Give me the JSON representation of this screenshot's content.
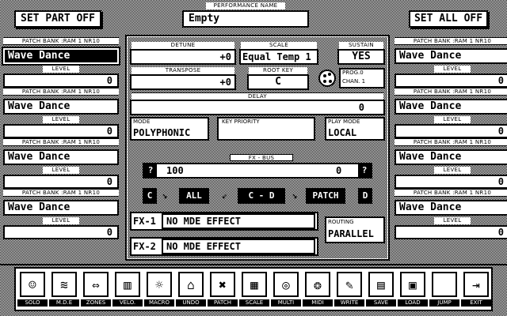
{
  "header": {
    "set_part_off": "SET PART OFF",
    "performance_name_label": "PERFORMANCE NAME",
    "performance_name": "Empty",
    "set_all_off": "SET ALL OFF"
  },
  "parts_left": [
    {
      "bank_label": "PATCH BANK :RAM 1 NR10",
      "patch": "Wave Dance",
      "level_label": "LEVEL",
      "level": "0",
      "selected": true
    },
    {
      "bank_label": "PATCH BANK :RAM 1 NR10",
      "patch": "Wave Dance",
      "level_label": "LEVEL",
      "level": "0"
    },
    {
      "bank_label": "PATCH BANK :RAM 1 NR10",
      "patch": "Wave Dance",
      "level_label": "LEVEL",
      "level": "0"
    },
    {
      "bank_label": "PATCH BANK :RAM 1 NR10",
      "patch": "Wave Dance",
      "level_label": "LEVEL",
      "level": "0"
    }
  ],
  "parts_right": [
    {
      "bank_label": "PATCH BANK :RAM 1 NR10",
      "patch": "Wave Dance",
      "level_label": "LEVEL",
      "level": "0"
    },
    {
      "bank_label": "PATCH BANK :RAM 1 NR10",
      "patch": "Wave Dance",
      "level_label": "LEVEL",
      "level": "0"
    },
    {
      "bank_label": "PATCH BANK :RAM 1 NR10",
      "patch": "Wave Dance",
      "level_label": "LEVEL",
      "level": "0"
    },
    {
      "bank_label": "PATCH BANK :RAM 1 NR10",
      "patch": "Wave Dance",
      "level_label": "LEVEL",
      "level": "0"
    }
  ],
  "center": {
    "detune_label": "DETUNE",
    "detune": "+0",
    "scale_label": "SCALE",
    "scale": "Equal Temp 1",
    "sustain_label": "SUSTAIN",
    "sustain": "YES",
    "transpose_label": "TRANSPOSE",
    "transpose": "+0",
    "root_key_label": "ROOT KEY",
    "root_key": "C",
    "prog_line": "PROG.0",
    "chan_line": "CHAN. 1",
    "delay_label": "DELAY",
    "delay": "0",
    "mode_label": "MODE",
    "mode": "POLYPHONIC",
    "key_priority_label": "KEY PRIORITY",
    "play_mode_label": "PLAY MODE",
    "play_mode": "LOCAL",
    "fx_bus_label": "FX - BUS",
    "fx_bus_left_btn": "?",
    "fx_bus_value": "100",
    "fx_bus_right_value": "0",
    "fx_bus_right_btn": "?",
    "route_c1": "C",
    "route_all": "ALL",
    "route_cd": "C - D",
    "route_patch": "PATCH",
    "route_d": "D",
    "fx1_label": "FX-1",
    "fx1_value": "NO MDE EFFECT",
    "fx2_label": "FX-2",
    "fx2_value": "NO MDE EFFECT",
    "routing_label": "ROUTING",
    "routing": "PARALLEL"
  },
  "toolbar": [
    {
      "label": "SOLO",
      "icon": "solo-icon",
      "glyph": "☺"
    },
    {
      "label": "M.D.E",
      "icon": "mde-icon",
      "glyph": "≋"
    },
    {
      "label": "ZONES",
      "icon": "zones-icon",
      "glyph": "⇔"
    },
    {
      "label": "VELO.",
      "icon": "velocity-icon",
      "glyph": "▥"
    },
    {
      "label": "MACRO",
      "icon": "macro-icon",
      "glyph": "☼"
    },
    {
      "label": "UNDO",
      "icon": "undo-icon",
      "glyph": "⌂"
    },
    {
      "label": "PATCH",
      "icon": "patch-icon",
      "glyph": "✖"
    },
    {
      "label": "SCALE",
      "icon": "scale-icon",
      "glyph": "▦"
    },
    {
      "label": "MULTI",
      "icon": "multi-icon",
      "glyph": "◎"
    },
    {
      "label": "MIDI",
      "icon": "midi-icon",
      "glyph": "❂"
    },
    {
      "label": "WRITE",
      "icon": "write-icon",
      "glyph": "✎"
    },
    {
      "label": "SAVE",
      "icon": "save-icon",
      "glyph": "▤"
    },
    {
      "label": "LOAD",
      "icon": "load-icon",
      "glyph": "▣"
    },
    {
      "label": "JUMP",
      "icon": "jump-icon",
      "glyph": ""
    },
    {
      "label": "EXIT",
      "icon": "exit-icon",
      "glyph": "⇥"
    }
  ]
}
